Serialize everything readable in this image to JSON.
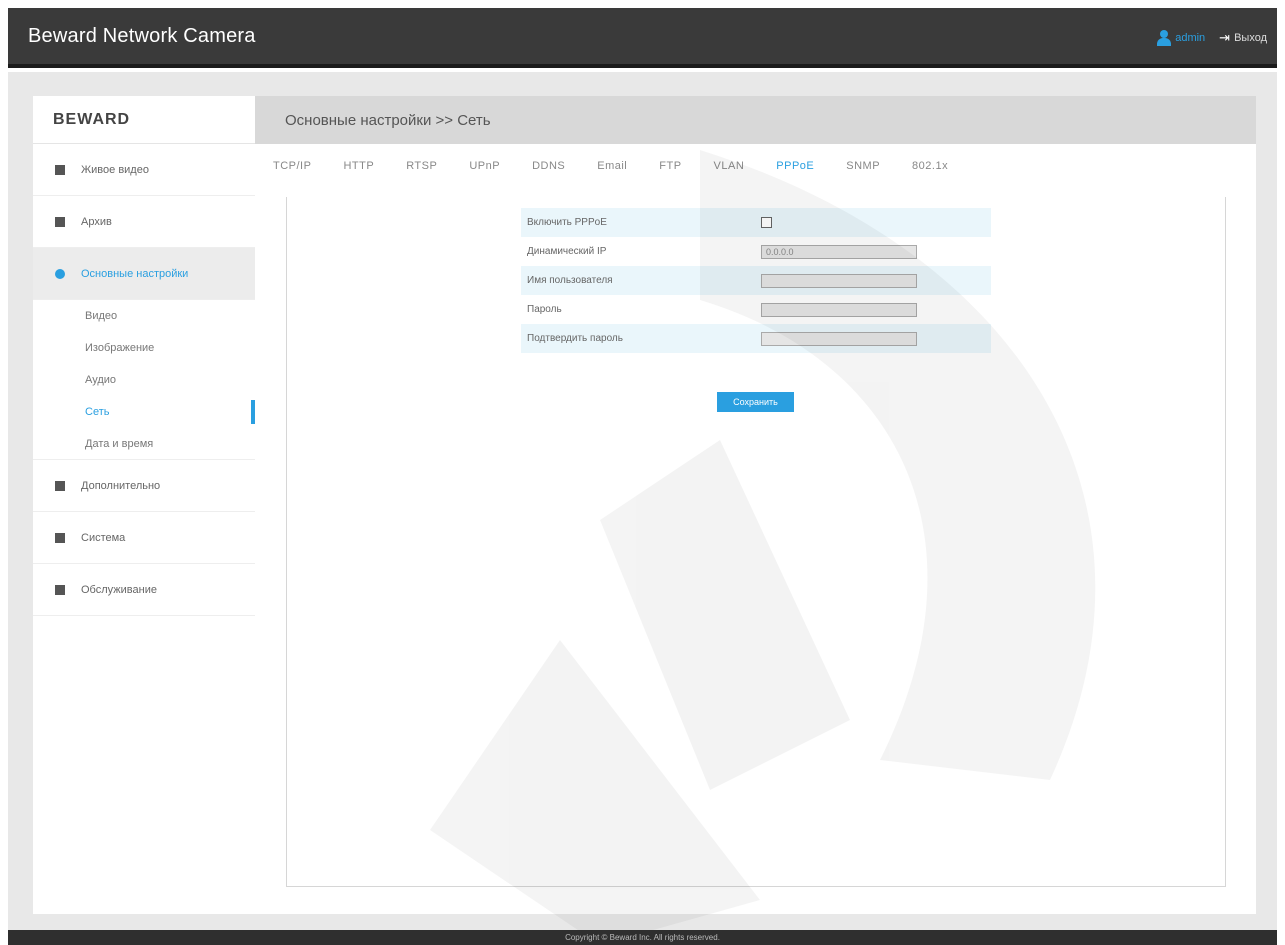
{
  "header": {
    "title": "Beward Network Camera",
    "user": "admin",
    "logout": "Выход"
  },
  "sidebar": {
    "logo": "BEWARD",
    "items": [
      {
        "label": "Живое видео",
        "icon": "camera-icon"
      },
      {
        "label": "Архив",
        "icon": "archive-icon"
      },
      {
        "label": "Основные настройки",
        "icon": "settings-icon",
        "active": true
      },
      {
        "label": "Дополнительно",
        "icon": "extra-icon"
      },
      {
        "label": "Система",
        "icon": "system-icon"
      },
      {
        "label": "Обслуживание",
        "icon": "maintenance-icon"
      }
    ],
    "subitems": [
      {
        "label": "Видео"
      },
      {
        "label": "Изображение"
      },
      {
        "label": "Аудио"
      },
      {
        "label": "Сеть",
        "active": true
      },
      {
        "label": "Дата и время"
      }
    ]
  },
  "breadcrumb": "Основные настройки >> Сеть",
  "tabs": [
    "TCP/IP",
    "HTTP",
    "RTSP",
    "UPnP",
    "DDNS",
    "Email",
    "FTP",
    "VLAN",
    "PPPoE",
    "SNMP",
    "802.1x"
  ],
  "active_tab": "PPPoE",
  "form": {
    "enable_label": "Включить PPPoE",
    "dynamic_ip_label": "Динамический IP",
    "dynamic_ip_value": "0.0.0.0",
    "username_label": "Имя пользователя",
    "password_label": "Пароль",
    "confirm_label": "Подтвердить пароль",
    "save_label": "Сохранить"
  },
  "footer": "Copyright © Beward Inc. All rights reserved.",
  "colors": {
    "accent": "#2a9fe0",
    "header": "#3a3a3a"
  }
}
